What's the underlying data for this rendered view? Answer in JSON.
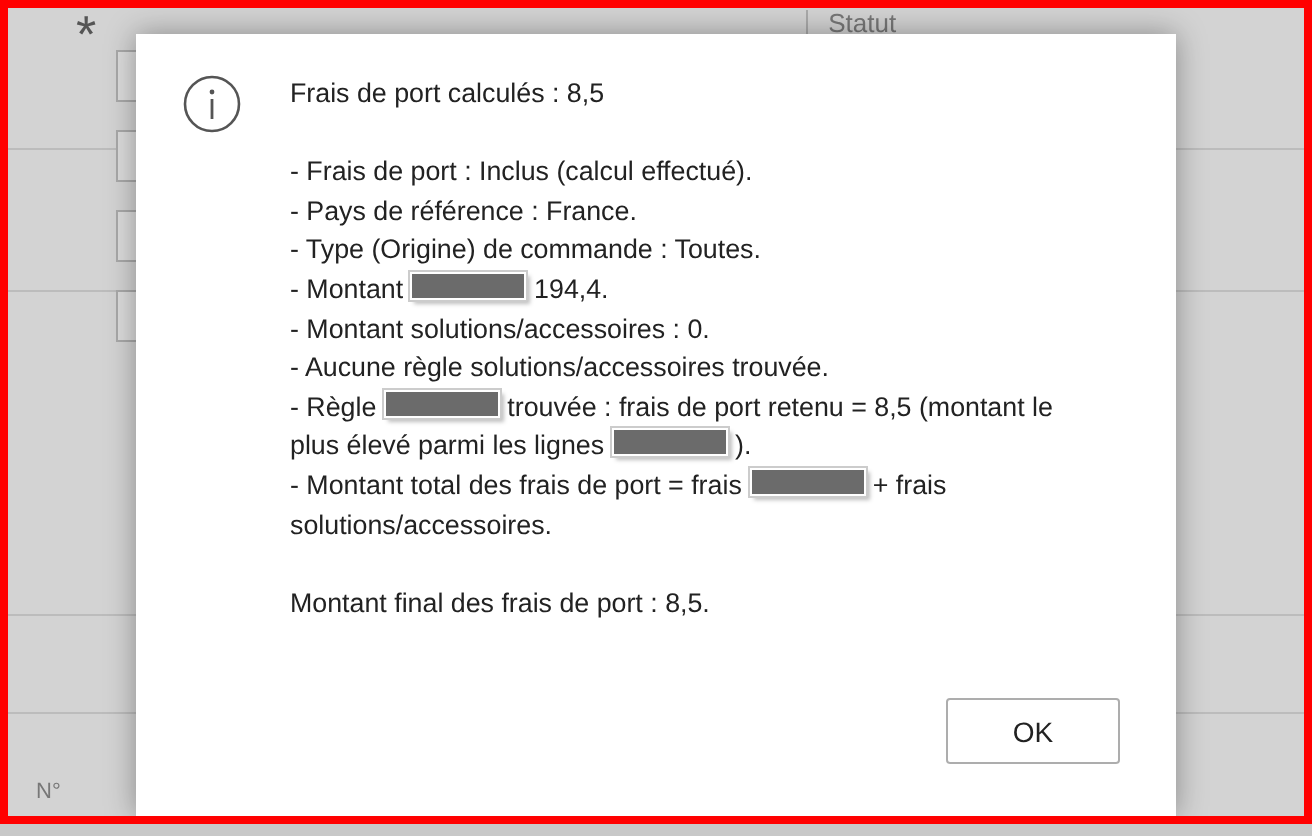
{
  "background": {
    "required_mark": "*",
    "column_header": "Statut",
    "footer_label": "N°"
  },
  "dialog": {
    "heading": [
      {
        "kind": "text",
        "text": "Frais de port calculés : 8,5"
      }
    ],
    "details": [
      [
        {
          "kind": "text",
          "text": "- Frais de port : Inclus (calcul effectué)."
        }
      ],
      [
        {
          "kind": "text",
          "text": "- Pays de référence : France."
        }
      ],
      [
        {
          "kind": "text",
          "text": "- Type (Origine) de commande : Toutes."
        }
      ],
      [
        {
          "kind": "text",
          "text": "- Montant"
        },
        {
          "kind": "redacted"
        },
        {
          "kind": "text",
          "text": "194,4."
        }
      ],
      [
        {
          "kind": "text",
          "text": "- Montant solutions/accessoires : 0."
        }
      ],
      [
        {
          "kind": "text",
          "text": "- Aucune règle solutions/accessoires trouvée."
        }
      ],
      [
        {
          "kind": "text",
          "text": "- Règle"
        },
        {
          "kind": "redacted"
        },
        {
          "kind": "text",
          "text": "trouvée : frais de port retenu = 8,5 (montant le plus élevé parmi les lignes"
        },
        {
          "kind": "redacted"
        },
        {
          "kind": "text",
          "text": ")."
        }
      ],
      [
        {
          "kind": "text",
          "text": "- Montant total des frais de port = frais"
        },
        {
          "kind": "redacted"
        },
        {
          "kind": "text",
          "text": "+ frais solutions/accessoires."
        }
      ]
    ],
    "conclusion": [
      {
        "kind": "text",
        "text": "Montant final des frais de port : 8,5."
      }
    ],
    "button": "OK"
  }
}
